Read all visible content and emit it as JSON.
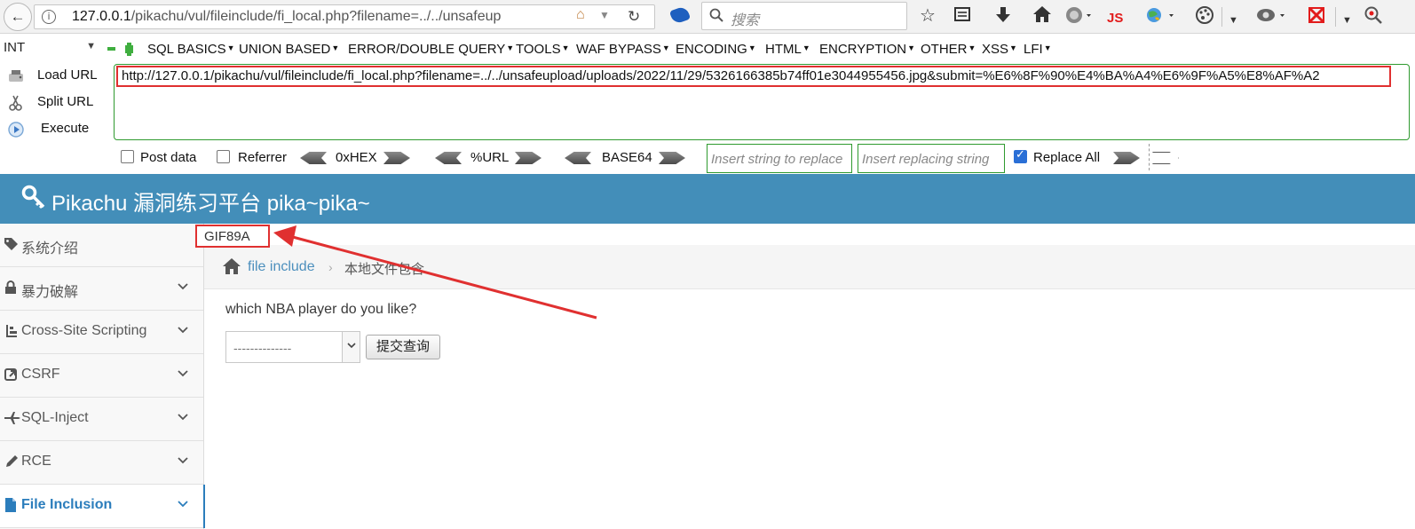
{
  "browser": {
    "url_host": "127.0.0.1",
    "url_rest": "/pikachu/vul/fileinclude/fi_local.php?filename=../../unsafeup",
    "search_placeholder": "搜索",
    "js_label": "JS"
  },
  "hackbar": {
    "encoding_select": "INT",
    "menus": [
      "SQL BASICS",
      "UNION BASED",
      "ERROR/DOUBLE QUERY",
      "TOOLS",
      "WAF BYPASS",
      "ENCODING",
      "HTML",
      "ENCRYPTION",
      "OTHER",
      "XSS",
      "LFI"
    ],
    "actions": [
      "Load URL",
      "Split URL",
      "Execute"
    ],
    "url_value": "http://127.0.0.1/pikachu/vul/fileinclude/fi_local.php?filename=../../unsafeupload/uploads/2022/11/29/5326166385b74ff01e3044955456.jpg&submit=%E6%8F%90%E4%BA%A4%E6%9F%A5%E8%AF%A2",
    "post_data_label": "Post data",
    "referrer_label": "Referrer",
    "hex_label": "0xHEX",
    "url_enc_label": "%URL",
    "base64_label": "BASE64",
    "replace_placeholder": "Insert string to replace",
    "replacing_placeholder": "Insert replacing string",
    "replace_all_label": "Replace All",
    "replace_all_checked": true
  },
  "site": {
    "title": "Pikachu 漏洞练习平台 pika~pika~",
    "sidebar": [
      {
        "label": "系统介绍",
        "icon": "tag-icon",
        "chevron": false
      },
      {
        "label": "暴力破解",
        "icon": "lock-icon",
        "chevron": true
      },
      {
        "label": "Cross-Site Scripting",
        "icon": "hierarchy-icon",
        "chevron": true
      },
      {
        "label": "CSRF",
        "icon": "external-link-icon",
        "chevron": true
      },
      {
        "label": "SQL-Inject",
        "icon": "plane-icon",
        "chevron": true
      },
      {
        "label": "RCE",
        "icon": "pencil-icon",
        "chevron": true
      },
      {
        "label": "File Inclusion",
        "icon": "file-icon",
        "chevron": true,
        "active": true
      }
    ],
    "output_text": "GIF89A",
    "breadcrumb_link": "file include",
    "breadcrumb_current": "本地文件包含",
    "question": "which NBA player do you like?",
    "select_value": "--------------",
    "submit_label": "提交查询",
    "header_color": "#438eb9",
    "highlight_color": "#e03030"
  }
}
